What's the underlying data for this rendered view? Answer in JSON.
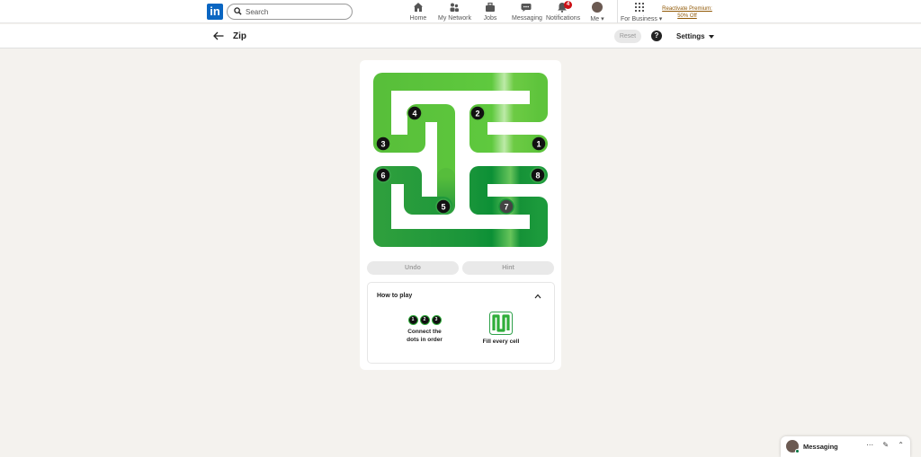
{
  "nav": {
    "logo": "in",
    "search_placeholder": "Search",
    "items": [
      {
        "label": "Home",
        "icon": "home-icon"
      },
      {
        "label": "My Network",
        "icon": "network-icon"
      },
      {
        "label": "Jobs",
        "icon": "briefcase-icon"
      },
      {
        "label": "Messaging",
        "icon": "chat-icon"
      },
      {
        "label": "Notifications",
        "icon": "bell-icon",
        "badge": "4"
      },
      {
        "label": "Me",
        "icon": "avatar"
      },
      {
        "label": "For Business",
        "icon": "grid-icon"
      }
    ],
    "premium_line1": "Reactivate Premium:",
    "premium_line2": "50% Off"
  },
  "subheader": {
    "title": "Zip",
    "reset_label": "Reset",
    "help_label": "?",
    "settings_label": "Settings"
  },
  "game": {
    "dots": [
      "1",
      "2",
      "3",
      "4",
      "5",
      "6",
      "7",
      "8"
    ],
    "undo_label": "Undo",
    "hint_label": "Hint",
    "howto_title": "How to play",
    "rule1_dots": [
      "1",
      "2",
      "3"
    ],
    "rule1_line1": "Connect the",
    "rule1_line2": "dots in order",
    "rule2_text": "Fill every cell",
    "colors": {
      "path_light": "#6dc93e",
      "path_dark": "#0d9337",
      "board_bg": "#ffffff"
    }
  },
  "messaging": {
    "label": "Messaging",
    "more": "⋯",
    "compose": "✎",
    "collapse": "⌃"
  }
}
